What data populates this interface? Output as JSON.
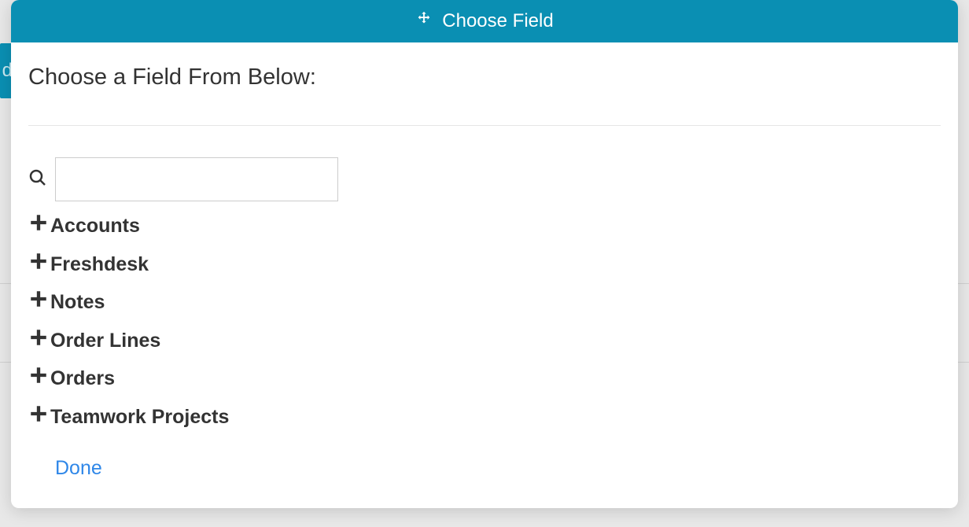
{
  "backdrop": {
    "tab_fragment": "d"
  },
  "modal": {
    "title": "Choose Field",
    "subtitle": "Choose a Field From Below:",
    "search": {
      "value": "",
      "placeholder": ""
    },
    "tree": [
      {
        "label": "Accounts"
      },
      {
        "label": "Freshdesk"
      },
      {
        "label": "Notes"
      },
      {
        "label": "Order Lines"
      },
      {
        "label": "Orders"
      },
      {
        "label": "Teamwork Projects"
      }
    ],
    "done_label": "Done"
  }
}
